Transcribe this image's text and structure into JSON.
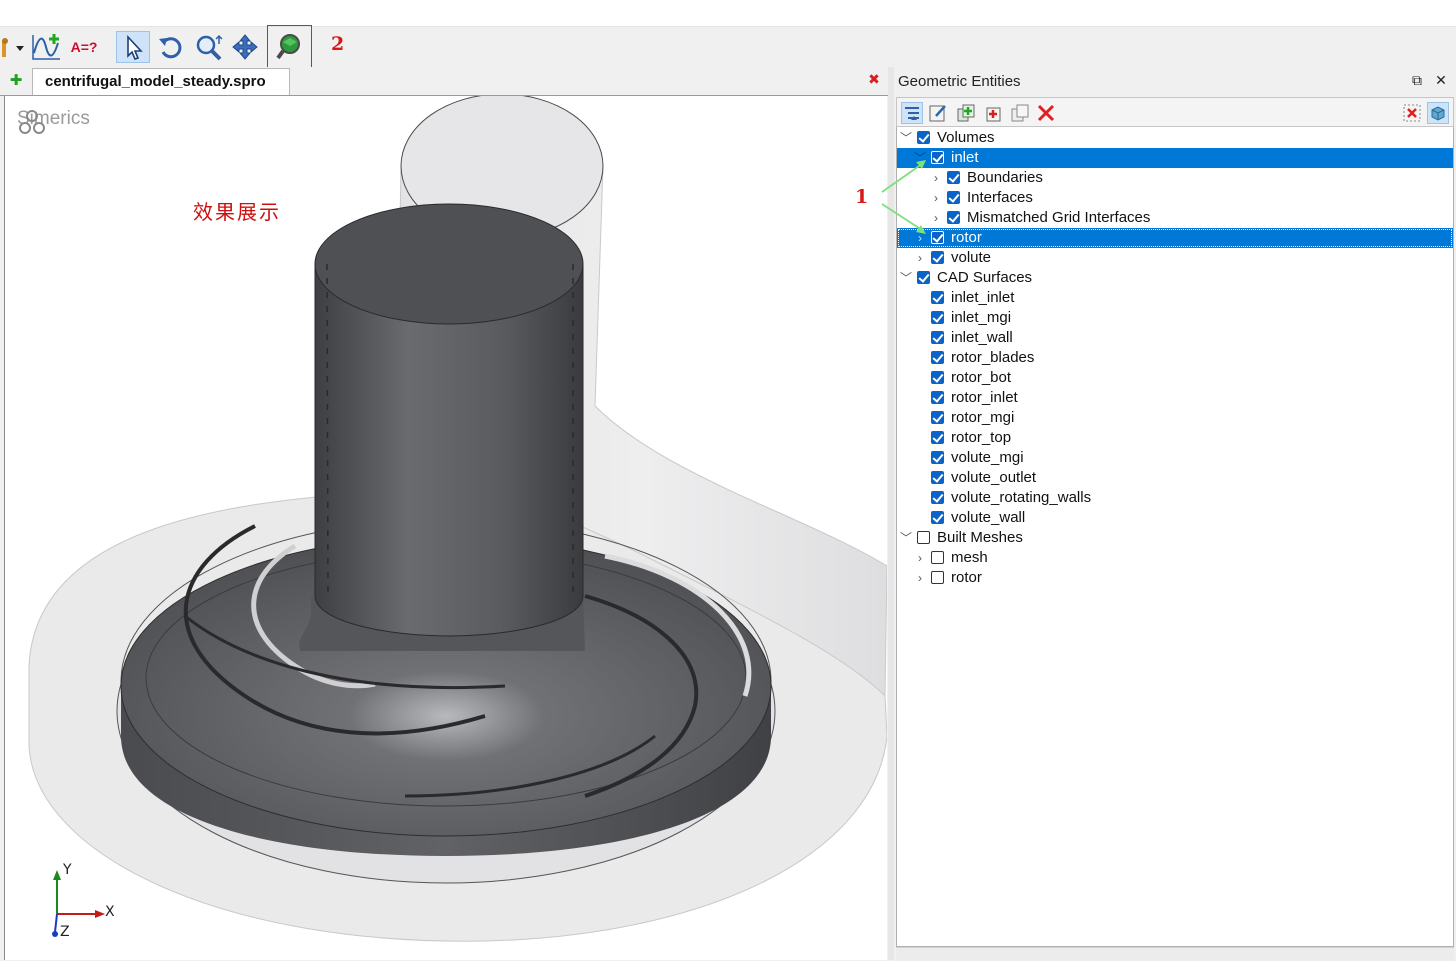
{
  "toolbar": {
    "formula_label": "A=?",
    "annotation_number": "2"
  },
  "document": {
    "tab_title": "centrifugal_model_steady.spro",
    "close_symbol": "✖",
    "new_symbol": "✚"
  },
  "viewport": {
    "brand": "Simerics",
    "caption": "效果展示",
    "axes": {
      "y": "Y",
      "x": "X",
      "z": "Z"
    }
  },
  "panel": {
    "title": "Geometric Entities",
    "annotation_number": "1",
    "tree": {
      "volumes": {
        "label": "Volumes",
        "items": [
          {
            "label": "inlet",
            "children": [
              "Boundaries",
              "Interfaces",
              "Mismatched Grid Interfaces"
            ]
          },
          {
            "label": "rotor"
          },
          {
            "label": "volute"
          }
        ]
      },
      "cad_surfaces": {
        "label": "CAD Surfaces",
        "items": [
          "inlet_inlet",
          "inlet_mgi",
          "inlet_wall",
          "rotor_blades",
          "rotor_bot",
          "rotor_inlet",
          "rotor_mgi",
          "rotor_top",
          "volute_mgi",
          "volute_outlet",
          "volute_rotating_walls",
          "volute_wall"
        ]
      },
      "built_meshes": {
        "label": "Built Meshes",
        "items": [
          "mesh",
          "rotor"
        ]
      }
    }
  },
  "colors": {
    "selection": "#0078d7",
    "checkbox": "#0a63c9",
    "annotation_red": "#d81818",
    "annotation_arrow": "#7de07d",
    "model_gray": "#5c5d61"
  }
}
